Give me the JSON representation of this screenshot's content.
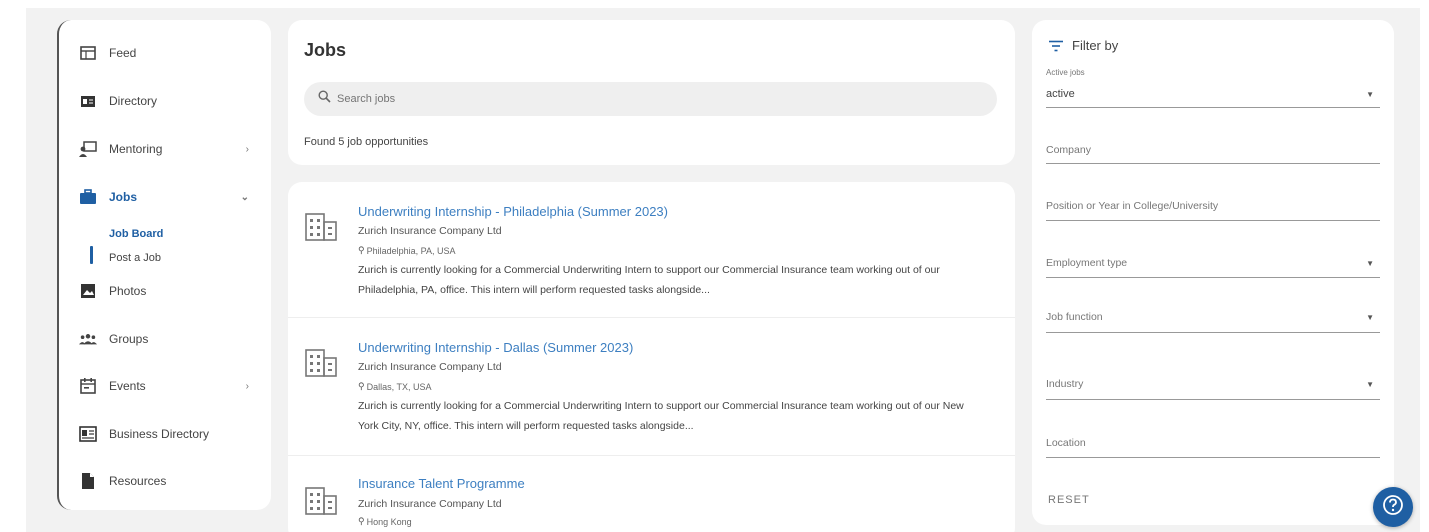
{
  "sidebar": {
    "items": [
      {
        "label": "Feed",
        "icon": "feed-icon"
      },
      {
        "label": "Directory",
        "icon": "directory-icon"
      },
      {
        "label": "Mentoring",
        "icon": "mentoring-icon",
        "chevron": "›"
      },
      {
        "label": "Jobs",
        "icon": "briefcase-icon",
        "chevron": "⌄"
      },
      {
        "label": "Photos",
        "icon": "photos-icon"
      },
      {
        "label": "Groups",
        "icon": "groups-icon"
      },
      {
        "label": "Events",
        "icon": "calendar-icon",
        "chevron": "›"
      },
      {
        "label": "Business Directory",
        "icon": "business-card-icon"
      },
      {
        "label": "Resources",
        "icon": "file-icon"
      }
    ],
    "jobs_subitems": [
      {
        "label": "Job Board"
      },
      {
        "label": "Post a Job"
      }
    ]
  },
  "header": {
    "title": "Jobs",
    "search_placeholder": "Search jobs",
    "found_text": "Found 5 job opportunities"
  },
  "jobs": [
    {
      "title": "Underwriting Internship - Philadelphia (Summer 2023)",
      "company": "Zurich Insurance Company Ltd",
      "location": "Philadelphia, PA, USA",
      "description": "Zurich is currently looking for a Commercial Underwriting Intern to support our Commercial Insurance team working out of our Philadelphia, PA, office. This intern will perform requested tasks alongside..."
    },
    {
      "title": "Underwriting Internship - Dallas (Summer 2023)",
      "company": "Zurich Insurance Company Ltd",
      "location": "Dallas, TX, USA",
      "description": "Zurich is currently looking for a Commercial Underwriting Intern to support our Commercial Insurance team working out of our New York City, NY, office. This intern will perform requested tasks alongside..."
    },
    {
      "title": "Insurance Talent Programme",
      "company": "Zurich Insurance Company Ltd",
      "location": "Hong Kong",
      "description": ""
    }
  ],
  "filter": {
    "title": "Filter by",
    "active_jobs_label": "Active jobs",
    "active_jobs_value": "active",
    "company_placeholder": "Company",
    "position_placeholder": "Position or Year in College/University",
    "employment_placeholder": "Employment type",
    "job_function_placeholder": "Job function",
    "industry_placeholder": "Industry",
    "location_placeholder": "Location",
    "reset_label": "RESET"
  },
  "colors": {
    "accent": "#1f5fa3",
    "link": "#3d7fc1",
    "background": "#f2f2f2"
  }
}
